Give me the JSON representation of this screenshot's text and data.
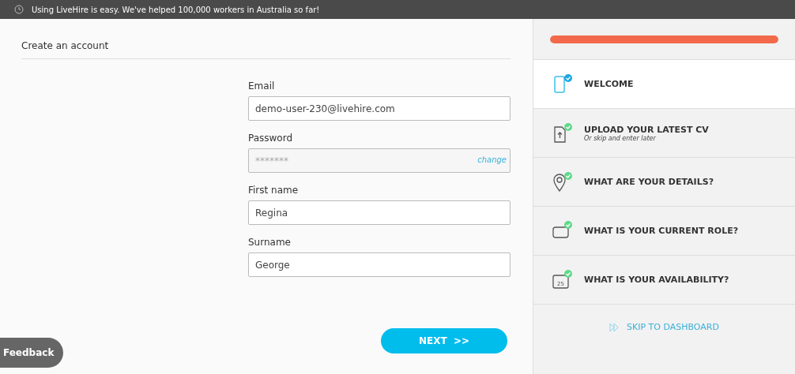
{
  "banner": {
    "text": "Using LiveHire is easy. We've helped 100,000 workers in Australia so far!"
  },
  "form": {
    "title": "Create an account",
    "fields": [
      {
        "label": "Email",
        "value": "demo-user-230@livehire.com"
      },
      {
        "label": "Password",
        "placeholder": "*******",
        "action": "change"
      },
      {
        "label": "First name",
        "value": "Regina"
      },
      {
        "label": "Surname",
        "value": "George"
      }
    ],
    "submit": "NEXT  >>"
  },
  "feedback": "Feedback",
  "progress": {
    "level": 1
  },
  "steps": [
    {
      "kind": "phone",
      "title": "WELCOME",
      "selected": true,
      "done": true
    },
    {
      "kind": "upload",
      "title": "UPLOAD YOUR LATEST CV",
      "subtitle": "Or skip and enter later",
      "selected": false,
      "done": true
    },
    {
      "kind": "pin",
      "title": "WHAT ARE YOUR DETAILS?",
      "selected": false,
      "done": true
    },
    {
      "kind": "briefcase",
      "title": "WHAT IS YOUR CURRENT ROLE?",
      "selected": false,
      "done": true
    },
    {
      "kind": "calendar",
      "title": "WHAT IS YOUR AVAILABILITY?",
      "day": "25",
      "selected": false,
      "done": true
    }
  ],
  "skip": "SKIP TO DASHBOARD"
}
